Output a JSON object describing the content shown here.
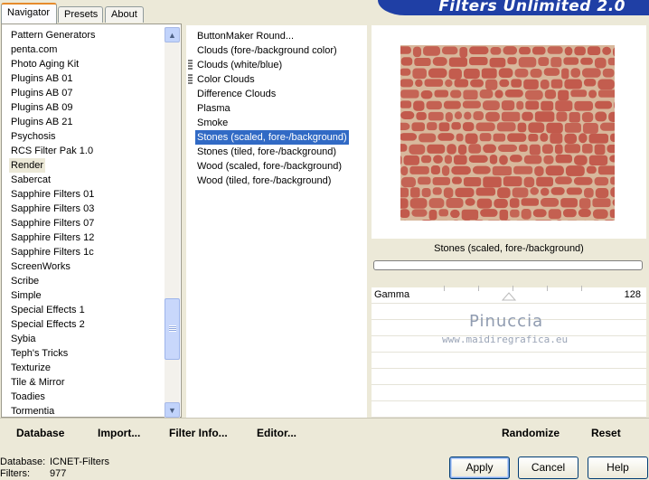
{
  "tabs": [
    {
      "label": "Navigator",
      "active": true
    },
    {
      "label": "Presets",
      "active": false
    },
    {
      "label": "About",
      "active": false
    }
  ],
  "banner_title": "Filters Unlimited 2.0",
  "categories": [
    "Pattern Generators",
    "penta.com",
    "Photo Aging Kit",
    "Plugins AB 01",
    "Plugins AB 07",
    "Plugins AB 09",
    "Plugins AB 21",
    "Psychosis",
    "RCS Filter Pak 1.0",
    "Render",
    "Sabercat",
    "Sapphire Filters 01",
    "Sapphire Filters 03",
    "Sapphire Filters 07",
    "Sapphire Filters 12",
    "Sapphire Filters 1c",
    "ScreenWorks",
    "Scribe",
    "Simple",
    "Special Effects 1",
    "Special Effects 2",
    "Sybia",
    "Teph's Tricks",
    "Texturize",
    "Tile & Mirror",
    "Toadies",
    "Tormentia"
  ],
  "selected_category": "Render",
  "filters": [
    "ButtonMaker Round...",
    "Clouds (fore-/background color)",
    "Clouds (white/blue)",
    "Color Clouds",
    "Difference Clouds",
    "Plasma",
    "Smoke",
    "Stones (scaled, fore-/background)",
    "Stones (tiled, fore-/background)",
    "Wood (scaled, fore-/background)",
    "Wood (tiled, fore-/background)"
  ],
  "selected_filter": "Stones (scaled, fore-/background)",
  "preview": {
    "caption": "Stones (scaled, fore-/background)",
    "stone_color": "#c25a4c",
    "mortar_color": "#d8b89c"
  },
  "params": [
    {
      "label": "Gamma",
      "value": "128",
      "slider_fraction": 0.5
    }
  ],
  "watermark": {
    "name": "Pinuccia",
    "site": "www.maidiregrafica.eu"
  },
  "toolbar": {
    "database": "Database",
    "import": "Import...",
    "filter_info": "Filter Info...",
    "editor": "Editor...",
    "randomize": "Randomize",
    "reset": "Reset"
  },
  "status": {
    "database_label": "Database:",
    "database_value": "ICNET-Filters",
    "filters_label": "Filters:",
    "filters_value": "977"
  },
  "buttons": {
    "apply": "Apply",
    "cancel": "Cancel",
    "help": "Help"
  }
}
